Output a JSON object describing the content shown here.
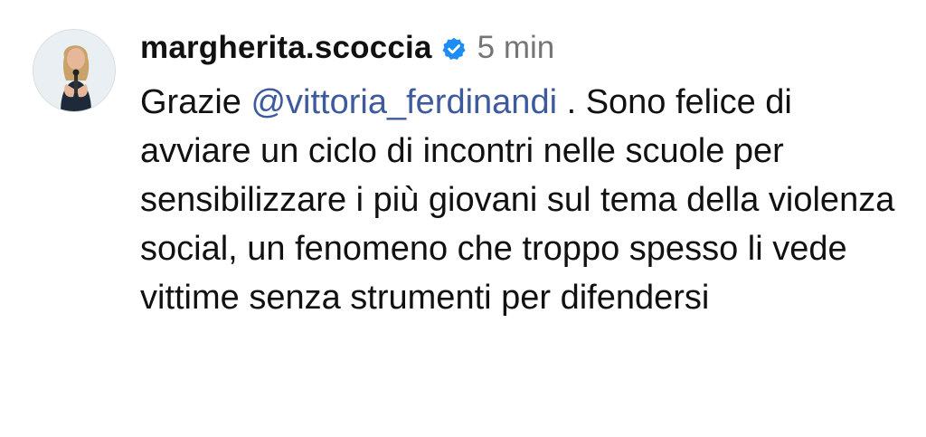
{
  "comment": {
    "username": "margherita.scoccia",
    "verified_icon": "verified-badge-icon",
    "time": "5 min",
    "text_before_mention": "Grazie ",
    "mention": "@vittoria_ferdinandi",
    "text_after_mention": " . Sono felice di avviare un ciclo di incontri nelle scuole per sensibilizzare i più giovani sul tema della violenza social, un fenomeno che troppo spesso li vede vittime senza strumenti per difendersi"
  },
  "colors": {
    "mention": "#3d5a9e",
    "verified": "#1d8cf5",
    "time": "#757575",
    "text": "#111111"
  }
}
